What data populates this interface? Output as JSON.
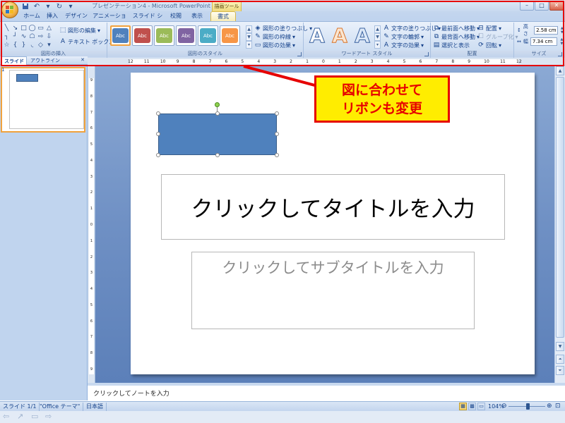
{
  "titlebar": {
    "title": "プレゼンテーション4 - Microsoft PowerPoint",
    "contextual_tool": "描画ツール"
  },
  "tabs": [
    {
      "label": "ホーム"
    },
    {
      "label": "挿入"
    },
    {
      "label": "デザイン"
    },
    {
      "label": "アニメーション"
    },
    {
      "label": "スライド ショー"
    },
    {
      "label": "校閲"
    },
    {
      "label": "表示"
    },
    {
      "label": "書式"
    }
  ],
  "ribbon": {
    "insert_shapes": {
      "label": "図形の挿入",
      "edit_shape": "図形の編集",
      "text_box": "テキスト ボックス"
    },
    "shape_styles": {
      "label": "図形のスタイル",
      "swatch_text": "Abc",
      "swatch_colors": [
        "#4f81bd",
        "#c0504d",
        "#9bbb59",
        "#8064a2",
        "#4bacc6",
        "#f79646"
      ],
      "fill": "図形の塗りつぶし",
      "outline": "図形の枠線",
      "effects": "図形の効果"
    },
    "wordart": {
      "label": "ワードアート スタイル",
      "letter": "A",
      "fill": "文字の塗りつぶし",
      "outline": "文字の輪郭",
      "effects": "文字の効果"
    },
    "arrange": {
      "label": "配置",
      "bring_front": "最前面へ移動",
      "send_back": "最背面へ移動",
      "selection_pane": "選択と表示",
      "align": "配置",
      "group": "グループ化",
      "rotate": "回転"
    },
    "size": {
      "label": "サイズ",
      "height_label": "高さ",
      "height_value": "2.58 cm",
      "width_label": "幅",
      "width_value": "7.34 cm"
    }
  },
  "left_pane": {
    "tab_slides": "スライド",
    "tab_outline": "アウトライン",
    "slide_number": "1"
  },
  "ruler": {
    "h_ticks": [
      "12",
      "11",
      "10",
      "9",
      "8",
      "7",
      "6",
      "5",
      "4",
      "3",
      "2",
      "1",
      "0",
      "1",
      "2",
      "3",
      "4",
      "5",
      "6",
      "7",
      "8",
      "9",
      "10",
      "11",
      "12"
    ],
    "v_ticks": [
      "9",
      "8",
      "7",
      "6",
      "5",
      "4",
      "3",
      "2",
      "1",
      "0",
      "1",
      "2",
      "3",
      "4",
      "5",
      "6",
      "7",
      "8",
      "9"
    ]
  },
  "slide": {
    "title_placeholder": "クリックしてタイトルを入力",
    "subtitle_placeholder": "クリックしてサブタイトルを入力",
    "shape_color": "#4f81bd"
  },
  "notes": {
    "placeholder": "クリックしてノートを入力"
  },
  "statusbar": {
    "slide_info": "スライド 1/1",
    "theme": "\"Office テーマ\"",
    "language": "日本語",
    "zoom": "104%"
  },
  "annotation": {
    "line1": "図に合わせて",
    "line2": "リボンも変更",
    "color": "#e60000",
    "bg": "#ffed00"
  }
}
